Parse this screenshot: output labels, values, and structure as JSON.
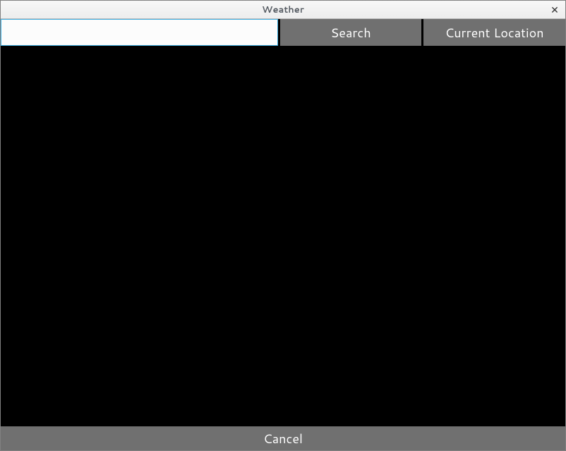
{
  "window": {
    "title": "Weather"
  },
  "toolbar": {
    "search_value": "",
    "search_placeholder": "",
    "search_button_label": "Search",
    "location_button_label": "Current Location"
  },
  "footer": {
    "cancel_label": "Cancel"
  }
}
